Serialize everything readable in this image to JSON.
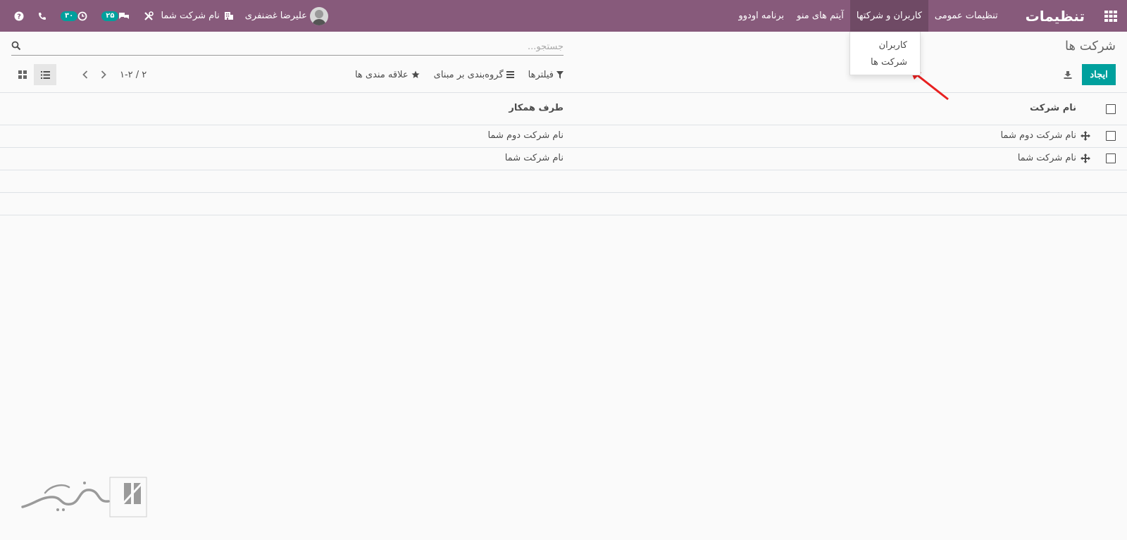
{
  "navbar": {
    "brand": "تنظیمات",
    "menu": [
      {
        "label": "تنظیمات عمومی"
      },
      {
        "label": "کاربران و شرکتها"
      },
      {
        "label": "آیتم های منو"
      },
      {
        "label": "برنامه اودوو"
      }
    ],
    "user_name": "علیرضا غضنفری",
    "company_name": "نام شرکت شما",
    "messages_count": "۲۵",
    "activities_count": "۳۰",
    "icons": [
      "apps-icon",
      "help-icon",
      "phone-icon",
      "activity-clock-icon",
      "chat-icon",
      "tools-icon"
    ],
    "bg_color": "#875a7b"
  },
  "dropdown": {
    "items": [
      {
        "label": "کاربران"
      },
      {
        "label": "شرکت ها"
      }
    ]
  },
  "control_panel": {
    "breadcrumb": "شرکت ها",
    "search_placeholder": "جستجو...",
    "create_label": "ایجاد",
    "filters_label": "فیلترها",
    "groupby_label": "گروه‌بندی بر مبنای",
    "favorites_label": "علاقه مندی ها",
    "pager_value": "۱-۲ / ۲",
    "accent_color": "#00a09d"
  },
  "list": {
    "columns": {
      "name": "نام شرکت",
      "partner": "طرف همکار"
    },
    "rows": [
      {
        "name": "نام شرکت دوم شما",
        "partner": "نام شرکت دوم شما"
      },
      {
        "name": "نام شرکت شما",
        "partner": "نام شرکت شما"
      }
    ]
  },
  "annotation": {
    "arrow_color": "#e82020"
  }
}
